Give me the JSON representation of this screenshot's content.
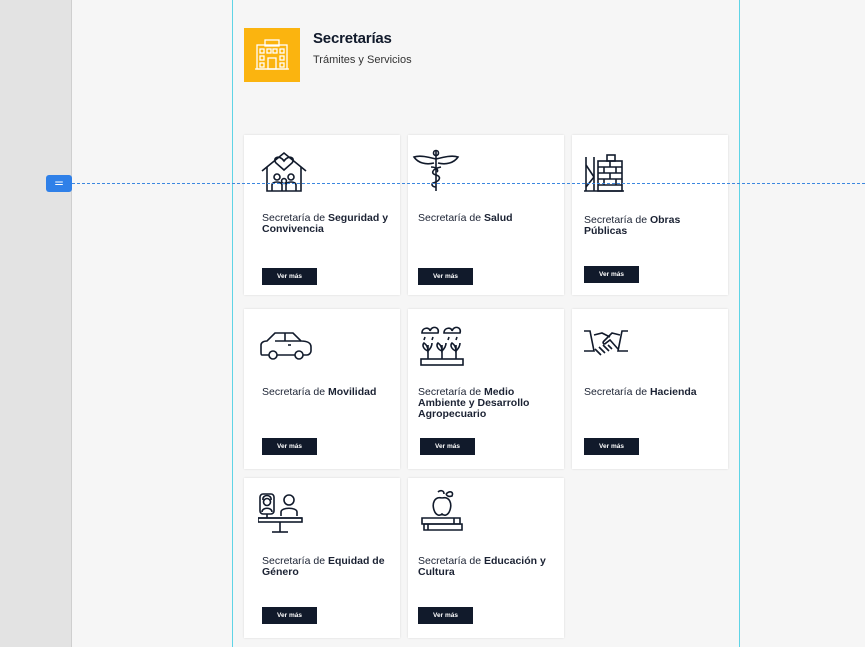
{
  "header": {
    "title": "Secretarías",
    "subtitle": "Trámites y Servicios",
    "icon": "building-icon",
    "accent_color": "#fbb40f"
  },
  "guide": {
    "handle_glyph": "="
  },
  "cards": [
    {
      "prefix": "Secretaría de ",
      "name": "Seguridad y Convivencia",
      "button": "Ver más",
      "icon": "house-family-icon"
    },
    {
      "prefix": "Secretaría de ",
      "name": "Salud",
      "button": "Ver más",
      "icon": "caduceus-icon"
    },
    {
      "prefix": "Secretaría de ",
      "name": "Obras Públicas",
      "button": "Ver más",
      "icon": "brick-wall-icon"
    },
    {
      "prefix": "Secretaría de ",
      "name": "Movilidad",
      "button": "Ver más",
      "icon": "car-icon"
    },
    {
      "prefix": "Secretaría de ",
      "name": "Medio Ambiente y Desarrollo Agropecuario",
      "button": "Ver más",
      "icon": "plants-icon"
    },
    {
      "prefix": "Secretaría de ",
      "name": "Hacienda",
      "button": "Ver más",
      "icon": "handshake-icon"
    },
    {
      "prefix": "Secretaría de ",
      "name": "Equidad de Género",
      "button": "Ver más",
      "icon": "gender-balance-icon"
    },
    {
      "prefix": "Secretaría de ",
      "name": "Educación y Cultura",
      "button": "Ver más",
      "icon": "apple-books-icon"
    }
  ],
  "colors": {
    "button_bg": "#111a2b",
    "frame_guide": "#5fd4e6",
    "guide_line": "#3b87e0"
  }
}
